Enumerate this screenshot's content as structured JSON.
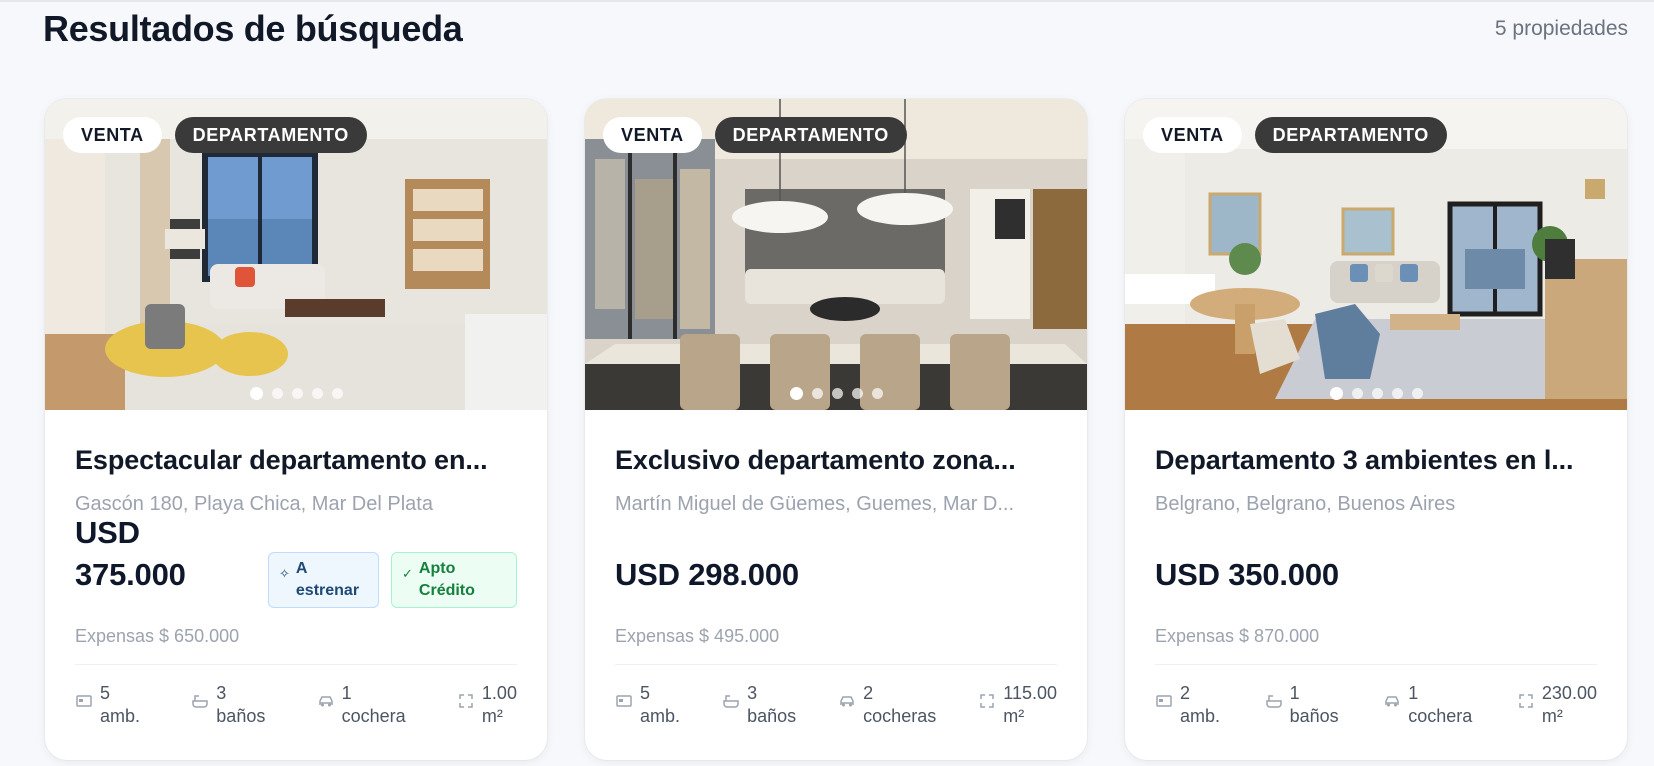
{
  "header": {
    "title": "Resultados de búsqueda",
    "count": "5 propiedades"
  },
  "cards": [
    {
      "operation": "VENTA",
      "type": "DEPARTAMENTO",
      "photo_dots": 5,
      "title": "Espectacular departamento en...",
      "address": "Gascón 180, Playa Chica, Mar Del Plata",
      "price_currency": "USD",
      "price_amount": "375.000",
      "expensas": "Expensas $ 650.000",
      "badges": [
        {
          "label_line1": "A",
          "label_line2": "estrenar",
          "icon": "sparkle-icon",
          "color": "#1e4a76"
        },
        {
          "label_line1": "Apto",
          "label_line2": "Crédito",
          "icon": "check-icon",
          "color": "#15803d"
        }
      ],
      "features": {
        "rooms": {
          "value": "5",
          "unit": "amb."
        },
        "baths": {
          "value": "3",
          "unit": "baños"
        },
        "garage": {
          "value": "1",
          "unit": "cochera"
        },
        "area": {
          "value": "1.00",
          "unit": "m²"
        }
      }
    },
    {
      "operation": "VENTA",
      "type": "DEPARTAMENTO",
      "photo_dots": 5,
      "title": "Exclusivo departamento zona...",
      "address": "Martín Miguel de Güemes, Guemes, Mar D...",
      "price": "USD 298.000",
      "expensas": "Expensas $ 495.000",
      "features": {
        "rooms": {
          "value": "5",
          "unit": "amb."
        },
        "baths": {
          "value": "3",
          "unit": "baños"
        },
        "garage": {
          "value": "2",
          "unit": "cocheras"
        },
        "area": {
          "value": "115.00",
          "unit": "m²"
        }
      }
    },
    {
      "operation": "VENTA",
      "type": "DEPARTAMENTO",
      "photo_dots": 5,
      "title": "Departamento 3 ambientes en l...",
      "address": "Belgrano, Belgrano, Buenos Aires",
      "price": "USD 350.000",
      "expensas": "Expensas $ 870.000",
      "features": {
        "rooms": {
          "value": "2",
          "unit": "amb."
        },
        "baths": {
          "value": "1",
          "unit": "baños"
        },
        "garage": {
          "value": "1",
          "unit": "cochera"
        },
        "area": {
          "value": "230.00",
          "unit": "m²"
        }
      }
    }
  ],
  "colors": {
    "background": "#f6f8fb",
    "text": "#111827",
    "muted": "#9ca3af",
    "chip_dark": "#3a3a3a"
  }
}
